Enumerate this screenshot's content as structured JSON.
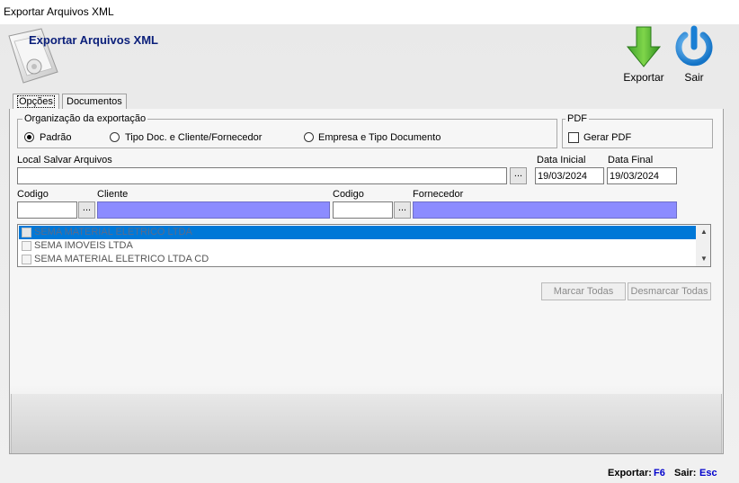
{
  "window": {
    "title": "Exportar Arquivos XML"
  },
  "header": {
    "title": "Exportar Arquivos XML",
    "icon": "document-folder-icon"
  },
  "toolbar": {
    "export_label": "Exportar",
    "exit_label": "Sair",
    "export_icon": "green-down-arrow-icon",
    "exit_icon": "power-icon"
  },
  "tabs": [
    {
      "label": "Opções",
      "active": true
    },
    {
      "label": "Documentos",
      "active": false
    }
  ],
  "organizacao": {
    "group_label": "Organização da exportação",
    "options": [
      {
        "label": "Padrão",
        "selected": true
      },
      {
        "label": "Tipo Doc. e  Cliente/Fornecedor",
        "selected": false
      },
      {
        "label": "Empresa e Tipo Documento",
        "selected": false
      }
    ]
  },
  "pdf": {
    "group_label": "PDF",
    "checkbox_label": "Gerar PDF",
    "checked": false
  },
  "local": {
    "label": "Local Salvar Arquivos",
    "value": "",
    "browse_label": "..."
  },
  "datas": {
    "inicial_label": "Data Inicial",
    "inicial_value": "19/03/2024",
    "final_label": "Data Final",
    "final_value": "19/03/2024"
  },
  "cliente": {
    "codigo_label": "Codigo",
    "label": "Cliente",
    "browse_label": "..."
  },
  "fornecedor": {
    "codigo_label": "Codigo",
    "label": "Fornecedor",
    "browse_label": "..."
  },
  "empresas": [
    {
      "name": "SEMA MATERIAL ELETRICO LTDA",
      "selected": true
    },
    {
      "name": "SEMA IMOVEIS LTDA",
      "selected": false
    },
    {
      "name": "SEMA MATERIAL ELETRICO LTDA CD",
      "selected": false
    }
  ],
  "list_buttons": {
    "marcar": "Marcar Todas",
    "desmarcar": "Desmarcar Todas"
  },
  "status": {
    "export_key": "Exportar:",
    "export_shortcut": "F6",
    "exit_key": "Sair:",
    "exit_shortcut": "Esc"
  },
  "colors": {
    "accent": "#0078d7",
    "lookup_field": "#8c8cff",
    "header_title": "#0b1f7a"
  }
}
